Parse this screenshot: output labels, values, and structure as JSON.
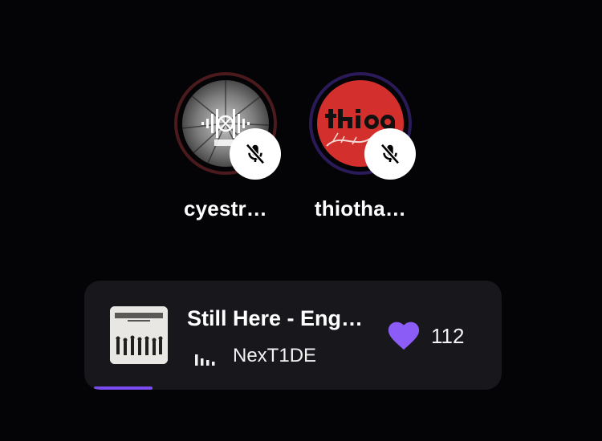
{
  "participants": [
    {
      "name": "cyestr…",
      "avatar_icon": "stream-logo-avatar",
      "ring_color": "#4a1a1c",
      "muted": true,
      "mute_icon": "mic-off-icon"
    },
    {
      "name": "thiotha…",
      "avatar_icon": "thio-thamm-logo-avatar",
      "ring_color": "#2a1a58",
      "muted": true,
      "mute_icon": "mic-off-icon"
    }
  ],
  "now_playing": {
    "title": "Still Here - Eng…",
    "artist": "NexT1DE",
    "playing_icon": "equalizer-icon",
    "like_icon": "heart-icon",
    "like_color": "#8b5cf6",
    "like_count": "112",
    "progress": 0.14,
    "progress_color": "#7b4cf2",
    "album_art_icon": "album-cover"
  }
}
